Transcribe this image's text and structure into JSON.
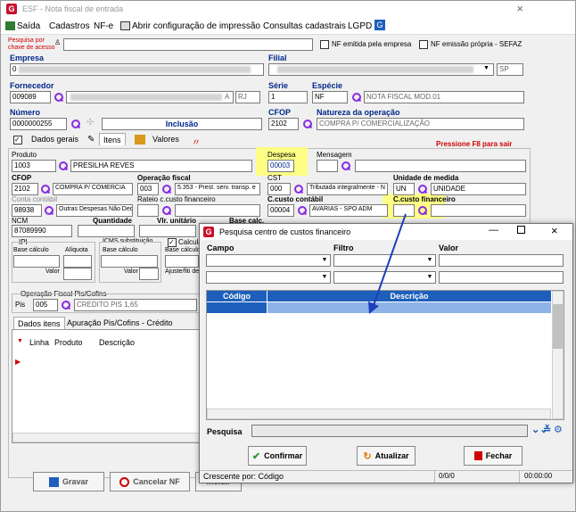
{
  "window": {
    "title": "ESF - Nota fiscal de entrada",
    "close": "×"
  },
  "menu": {
    "saida": "Saída",
    "cadastros": "Cadastros",
    "nfe": "NF-e",
    "print": "Abrir configuração de impressão",
    "consultas": "Consultas cadastrais",
    "lgpd": "LGPD"
  },
  "search": {
    "label1": "Pesquisa por",
    "label2": "chave de acesso",
    "nf_emitida": "NF emitida pela empresa",
    "nf_propria": "NF emissão própria - SEFAZ"
  },
  "empresa": {
    "label": "Empresa",
    "value": "0"
  },
  "filial": {
    "label": "Filial",
    "uf": "SP"
  },
  "fornecedor": {
    "label": "Fornecedor",
    "code": "009089",
    "suffix": "A",
    "uf": "RJ"
  },
  "serie": {
    "label": "Série",
    "value": "1"
  },
  "especie": {
    "label": "Espécie",
    "code": "NF",
    "desc": "NOTA FISCAL MOD.01"
  },
  "numero": {
    "label": "Número",
    "value": "0000000255",
    "status": "Inclusão"
  },
  "cfop": {
    "label": "CFOP",
    "value": "2102"
  },
  "natureza": {
    "label": "Natureza da operação",
    "value": "COMPRA P/ COMERCIALIZAÇÃO"
  },
  "tabs": {
    "dados": "Dados gerais",
    "itens": "Itens",
    "valores": "Valores"
  },
  "hint": "Pressione F8 para sair",
  "item": {
    "produto_label": "Produto",
    "produto_code": "1003",
    "produto_desc": "PRESILHA REVES",
    "despesa_label": "Despesa",
    "despesa_value": "00003",
    "mensagem_label": "Mensagem",
    "cfop_label": "CFOP",
    "cfop_code": "2102",
    "cfop_desc": "COMPRA P/ COMERCIA",
    "opfiscal_label": "Operação fiscal",
    "opfiscal_code": "003",
    "opfiscal_desc": "5.353 - Prest. serv. transp. e",
    "cst_label": "CST",
    "cst_code": "000",
    "cst_desc": "Tributada integralmente - N",
    "unidade_label": "Unidade de medida",
    "unidade_code": "UN",
    "unidade_desc": "UNIDADE",
    "conta_label": "Conta contábil",
    "conta_code": "98938",
    "conta_desc": "Outras Despesas Não Ded",
    "rateio_label": "Rateio c.custo financeiro",
    "ccusto_label": "C.custo contábil",
    "ccusto_code": "00004",
    "ccusto_desc": "AVARIAS - SPO ADM",
    "ccfin_label": "C.custo financeiro",
    "ncm_label": "NCM",
    "ncm_value": "87089990",
    "quantidade_label": "Quantidade",
    "vlr_label": "Vlr. unitário",
    "base_label": "Base calc.",
    "aliq_label": "Aliq. ICMS",
    "icms_label": "ICMS",
    "total_label": "Total",
    "ipi_label": "IPI",
    "base_calculo": "Base cálculo",
    "aliquota": "Alíquota",
    "valor": "Valor",
    "icms_st_label": "ICMS substituição",
    "calcula": "Calcula",
    "ajuste": "Ajuste/fiti de"
  },
  "piscofins": {
    "label": "Operação Fiscal Pis/Cofins",
    "pis_label": "Pis",
    "code": "005",
    "desc": "CREDITO PIS 1,65"
  },
  "subtabs": {
    "dados": "Dados itens",
    "apuracao": "Apuração Pis/Cofins - Crédito"
  },
  "itemgrid": {
    "cols": [
      "Linha",
      "Produto",
      "Descrição"
    ]
  },
  "footer": {
    "gravar": "Gravar",
    "cancelar": "Cancelar NF",
    "cancelar_u": "N",
    "incluir": "Incluir"
  },
  "dialog": {
    "title": "Pesquisa centro de custos financeiro",
    "campo": "Campo",
    "filtro": "Filtro",
    "valor": "Valor",
    "grid_cols": [
      "Código",
      "Descrição"
    ],
    "pesquisa": "Pesquisa",
    "confirmar": "Confirmar",
    "atualizar": "Atualizar",
    "fechar": "Fechar",
    "status_sort": "Crescente por: Código",
    "status_count": "0/0/0",
    "status_time": "00:00:00"
  },
  "colors": {
    "accent": "#1d5fbb",
    "label_blue": "#00288a",
    "highlight": "#ffff7a",
    "red": "#d00000"
  }
}
